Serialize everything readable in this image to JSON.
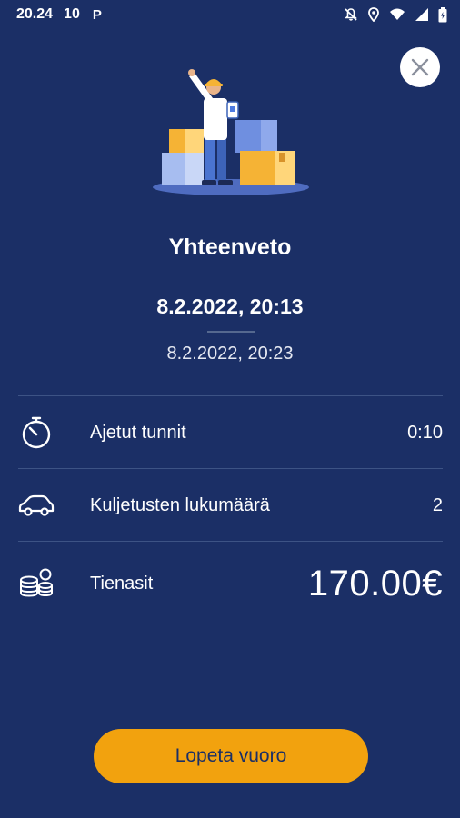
{
  "status_bar": {
    "time": "20.24",
    "notification_count": "10",
    "parking_letter": "P",
    "icons": [
      "p-icon",
      "bell-off-icon",
      "location-icon",
      "wifi-icon",
      "signal-icon",
      "battery-icon"
    ]
  },
  "header": {
    "close_icon": "close-icon"
  },
  "summary": {
    "title": "Yhteenveto",
    "start_time": "8.2.2022, 20:13",
    "end_time": "8.2.2022, 20:23"
  },
  "rows": [
    {
      "icon": "stopwatch-icon",
      "label": "Ajetut tunnit",
      "value": "0:10"
    },
    {
      "icon": "car-icon",
      "label": "Kuljetusten lukumäärä",
      "value": "2"
    },
    {
      "icon": "coins-icon",
      "label": "Tienasit",
      "value": "170.00€"
    }
  ],
  "action": {
    "end_shift_label": "Lopeta vuoro"
  },
  "colors": {
    "background": "#1b2f66",
    "accent": "#f2a20e",
    "divider": "#3d5385",
    "text": "#ffffff"
  }
}
